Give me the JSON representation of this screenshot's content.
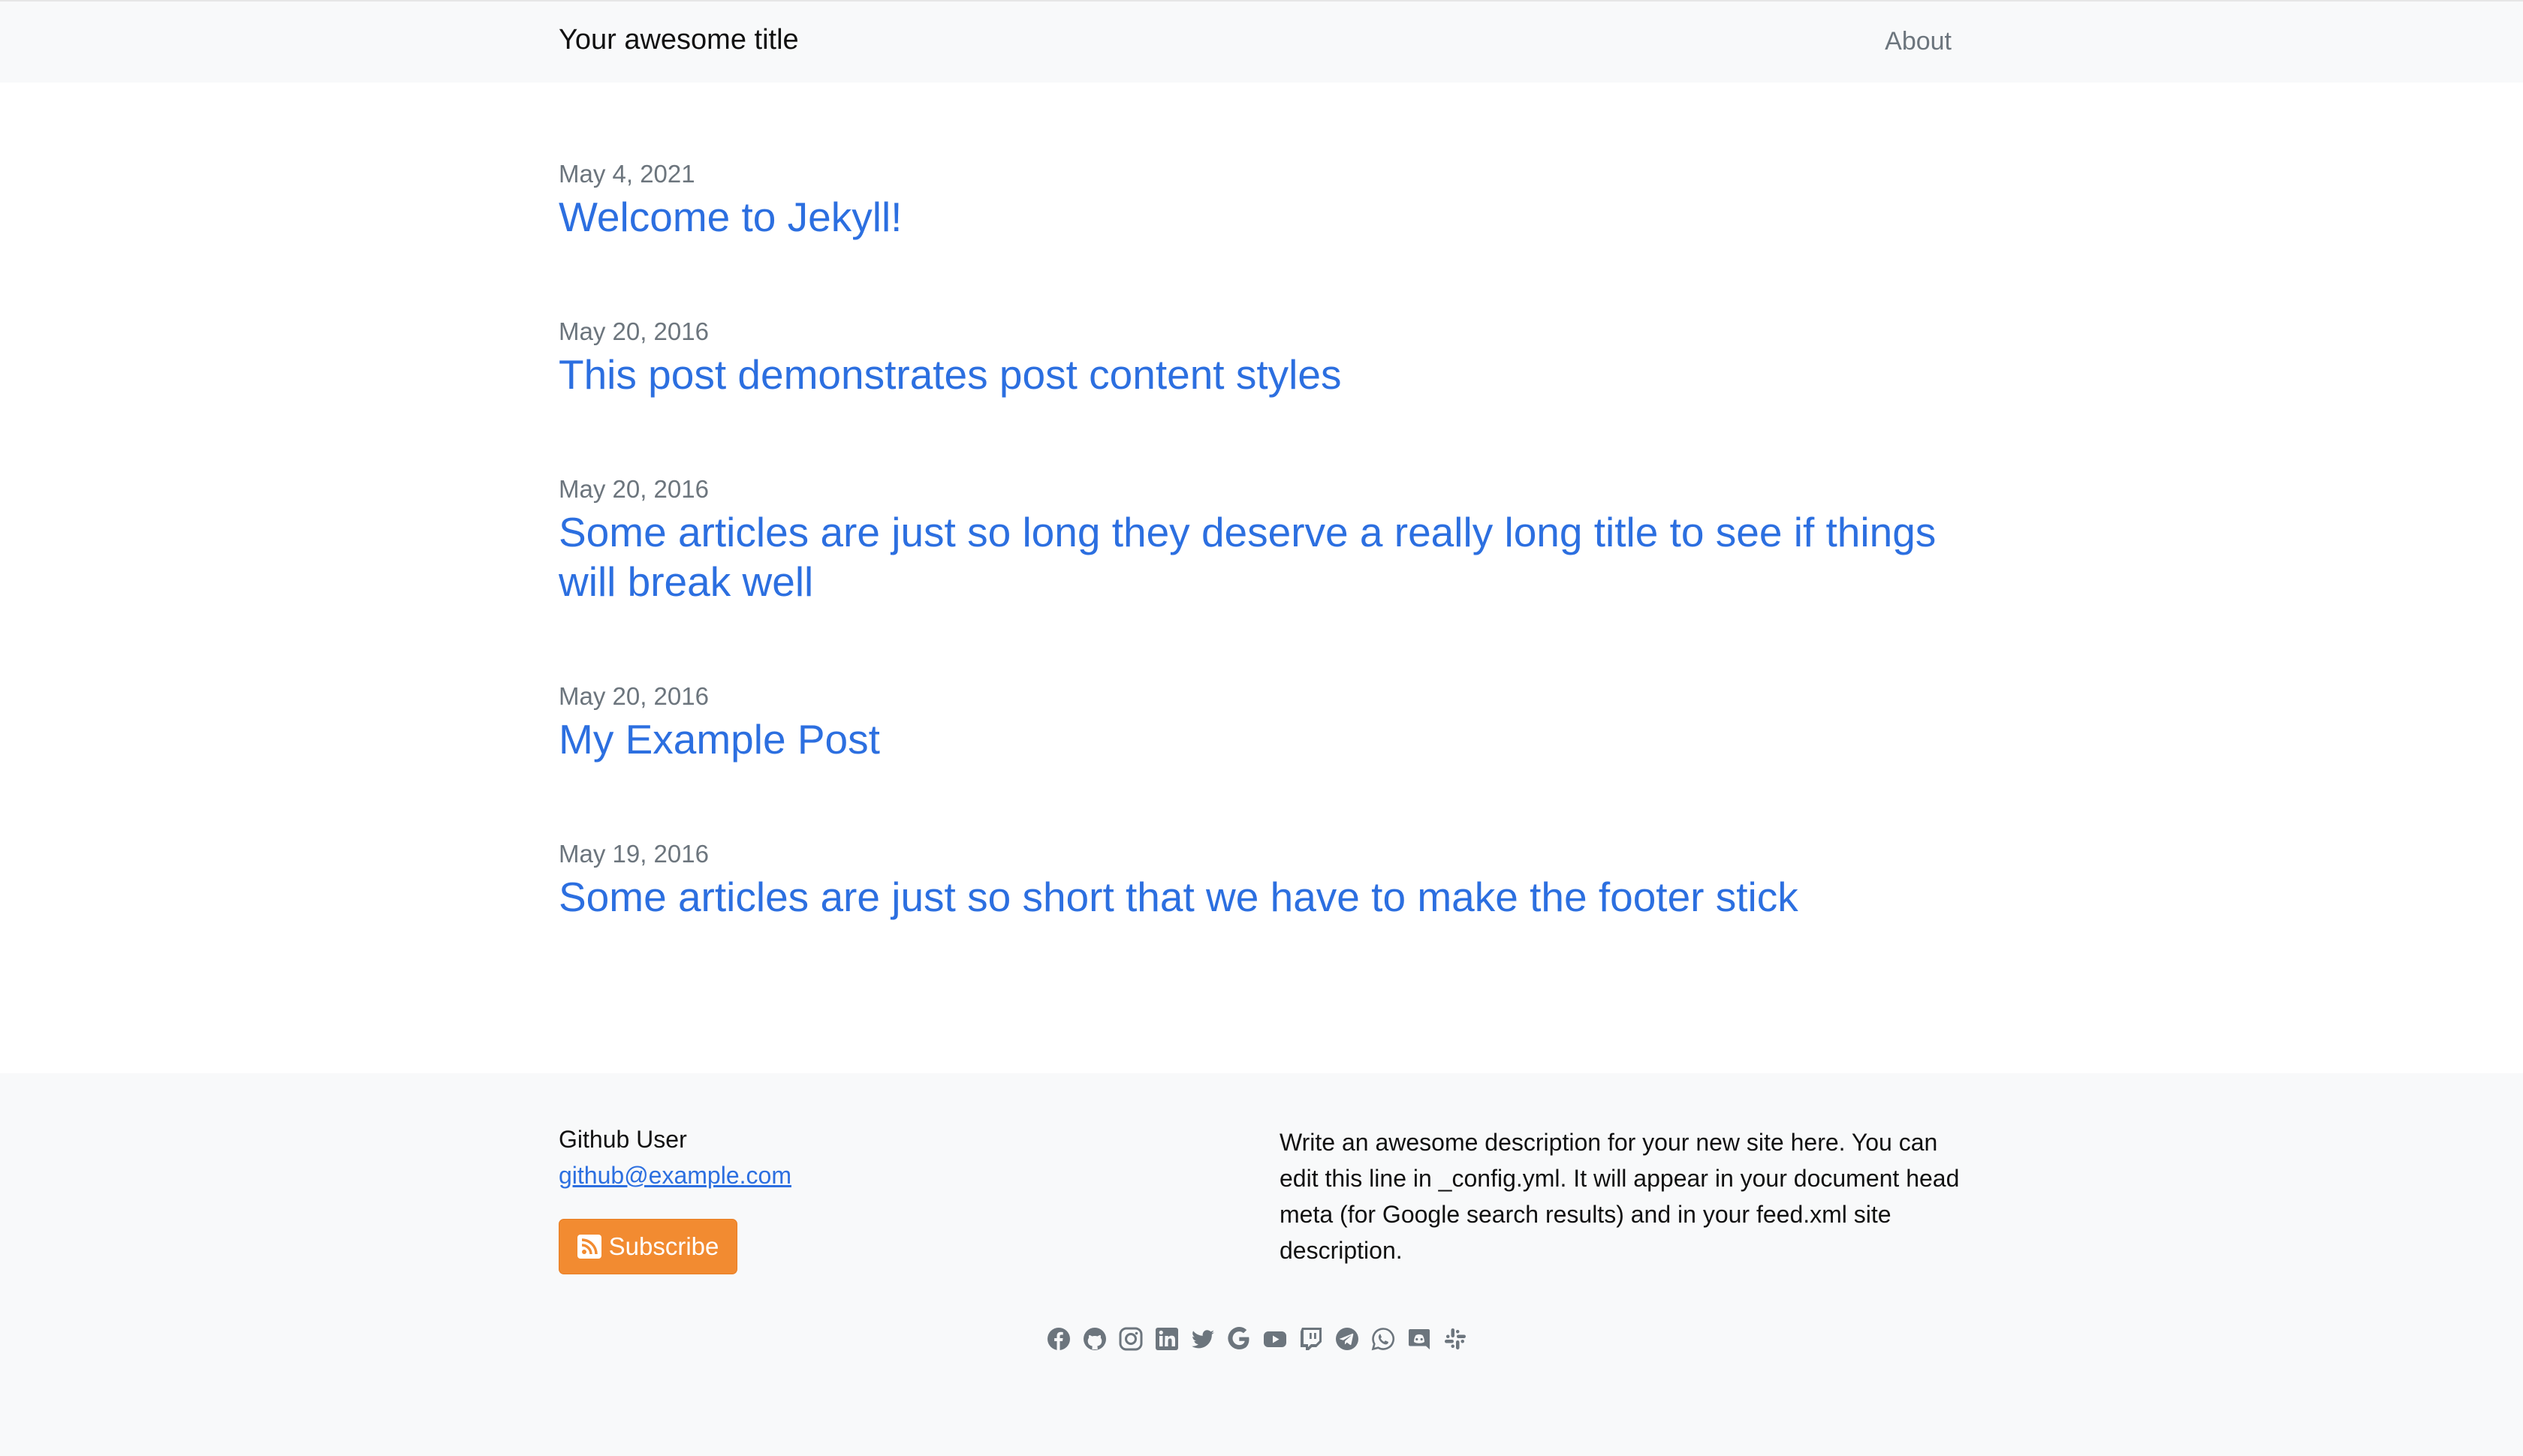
{
  "header": {
    "site_title": "Your awesome title",
    "nav": [
      {
        "label": "About"
      }
    ]
  },
  "posts": [
    {
      "date": "May 4, 2021",
      "title": "Welcome to Jekyll!"
    },
    {
      "date": "May 20, 2016",
      "title": "This post demonstrates post content styles"
    },
    {
      "date": "May 20, 2016",
      "title": "Some articles are just so long they deserve a really long title to see if things will break well"
    },
    {
      "date": "May 20, 2016",
      "title": "My Example Post"
    },
    {
      "date": "May 19, 2016",
      "title": "Some articles are just so short that we have to make the footer stick"
    }
  ],
  "footer": {
    "name": "Github User",
    "email": "github@example.com",
    "subscribe_label": "Subscribe",
    "description": "Write an awesome description for your new site here. You can edit this line in _config.yml. It will appear in your document head meta (for Google search results) and in your feed.xml site description.",
    "social_icons": [
      "facebook-icon",
      "github-icon",
      "instagram-icon",
      "linkedin-icon",
      "twitter-icon",
      "google-icon",
      "youtube-icon",
      "twitch-icon",
      "telegram-icon",
      "whatsapp-icon",
      "discord-icon",
      "slack-icon"
    ]
  },
  "colors": {
    "link": "#2c6fe0",
    "muted": "#6c757d",
    "subscribe_bg": "#f28b31",
    "navbar_bg": "#f8f9fa",
    "footer_bg": "#f8f9fa"
  }
}
